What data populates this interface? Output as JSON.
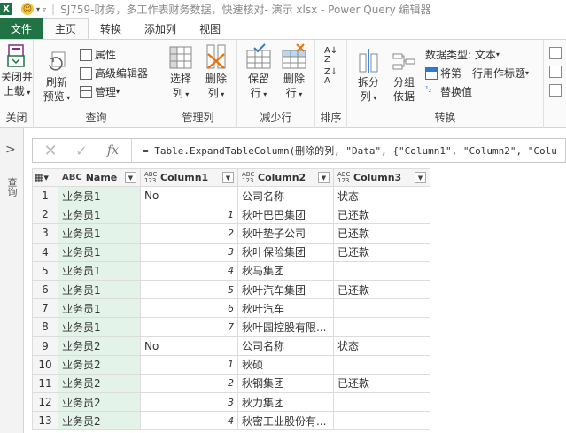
{
  "titlebar": {
    "logo": "X",
    "title": "SJ759-财务，多工作表财务数据，快速核对- 演示 xlsx - Power Query 编辑器"
  },
  "tabs": [
    {
      "label": "文件"
    },
    {
      "label": "主页"
    },
    {
      "label": "转换"
    },
    {
      "label": "添加列"
    },
    {
      "label": "视图"
    }
  ],
  "ribbon": {
    "close": {
      "label1": "关闭并",
      "label2": "上载",
      "group": "关闭"
    },
    "query": {
      "refresh1": "刷新",
      "refresh2": "预览",
      "properties": "属性",
      "advanced_editor": "高级编辑器",
      "manage": "管理",
      "group": "查询"
    },
    "manage_cols": {
      "choose1": "选择",
      "choose2": "列",
      "remove1": "删除",
      "remove2": "列",
      "group": "管理列"
    },
    "reduce_rows": {
      "keep1": "保留",
      "keep2": "行",
      "remove1": "删除",
      "remove2": "行",
      "group": "减少行"
    },
    "sort": {
      "group": "排序"
    },
    "transform": {
      "split1": "拆分",
      "split2": "列",
      "groupby1": "分组",
      "groupby2": "依据",
      "datatype": "数据类型: 文本",
      "first_row_header": "将第一行用作标题",
      "replace_values": "替换值",
      "group": "转换"
    }
  },
  "leftpanel": {
    "label": "查询"
  },
  "formula": {
    "text": "= Table.ExpandTableColumn(删除的列, \"Data\", {\"Column1\", \"Column2\", \"Colu"
  },
  "table": {
    "columns": [
      {
        "type": "ABC",
        "name": "Name"
      },
      {
        "type": "ABC 123",
        "name": "Column1"
      },
      {
        "type": "ABC 123",
        "name": "Column2"
      },
      {
        "type": "ABC 123",
        "name": "Column3"
      }
    ],
    "rows": [
      {
        "n": "1",
        "name": "业务员1",
        "c1": "No",
        "c2": "公司名称",
        "c3": "状态"
      },
      {
        "n": "2",
        "name": "业务员1",
        "c1": "1",
        "c2": "秋叶巴巴集团",
        "c3": "已还款"
      },
      {
        "n": "3",
        "name": "业务员1",
        "c1": "2",
        "c2": "秋叶垫子公司",
        "c3": "已还款"
      },
      {
        "n": "4",
        "name": "业务员1",
        "c1": "3",
        "c2": "秋叶保险集团",
        "c3": "已还款"
      },
      {
        "n": "5",
        "name": "业务员1",
        "c1": "4",
        "c2": "秋马集团",
        "c3": ""
      },
      {
        "n": "6",
        "name": "业务员1",
        "c1": "5",
        "c2": "秋叶汽车集团",
        "c3": "已还款"
      },
      {
        "n": "7",
        "name": "业务员1",
        "c1": "6",
        "c2": "秋叶汽车",
        "c3": ""
      },
      {
        "n": "8",
        "name": "业务员1",
        "c1": "7",
        "c2": "秋叶园控股有限...",
        "c3": ""
      },
      {
        "n": "9",
        "name": "业务员2",
        "c1": "No",
        "c2": "公司名称",
        "c3": "状态"
      },
      {
        "n": "10",
        "name": "业务员2",
        "c1": "1",
        "c2": "秋硕",
        "c3": ""
      },
      {
        "n": "11",
        "name": "业务员2",
        "c1": "2",
        "c2": "秋钢集团",
        "c3": "已还款"
      },
      {
        "n": "12",
        "name": "业务员2",
        "c1": "3",
        "c2": "秋力集团",
        "c3": ""
      },
      {
        "n": "13",
        "name": "业务员2",
        "c1": "4",
        "c2": "秋密工业股份有...",
        "c3": ""
      }
    ]
  }
}
